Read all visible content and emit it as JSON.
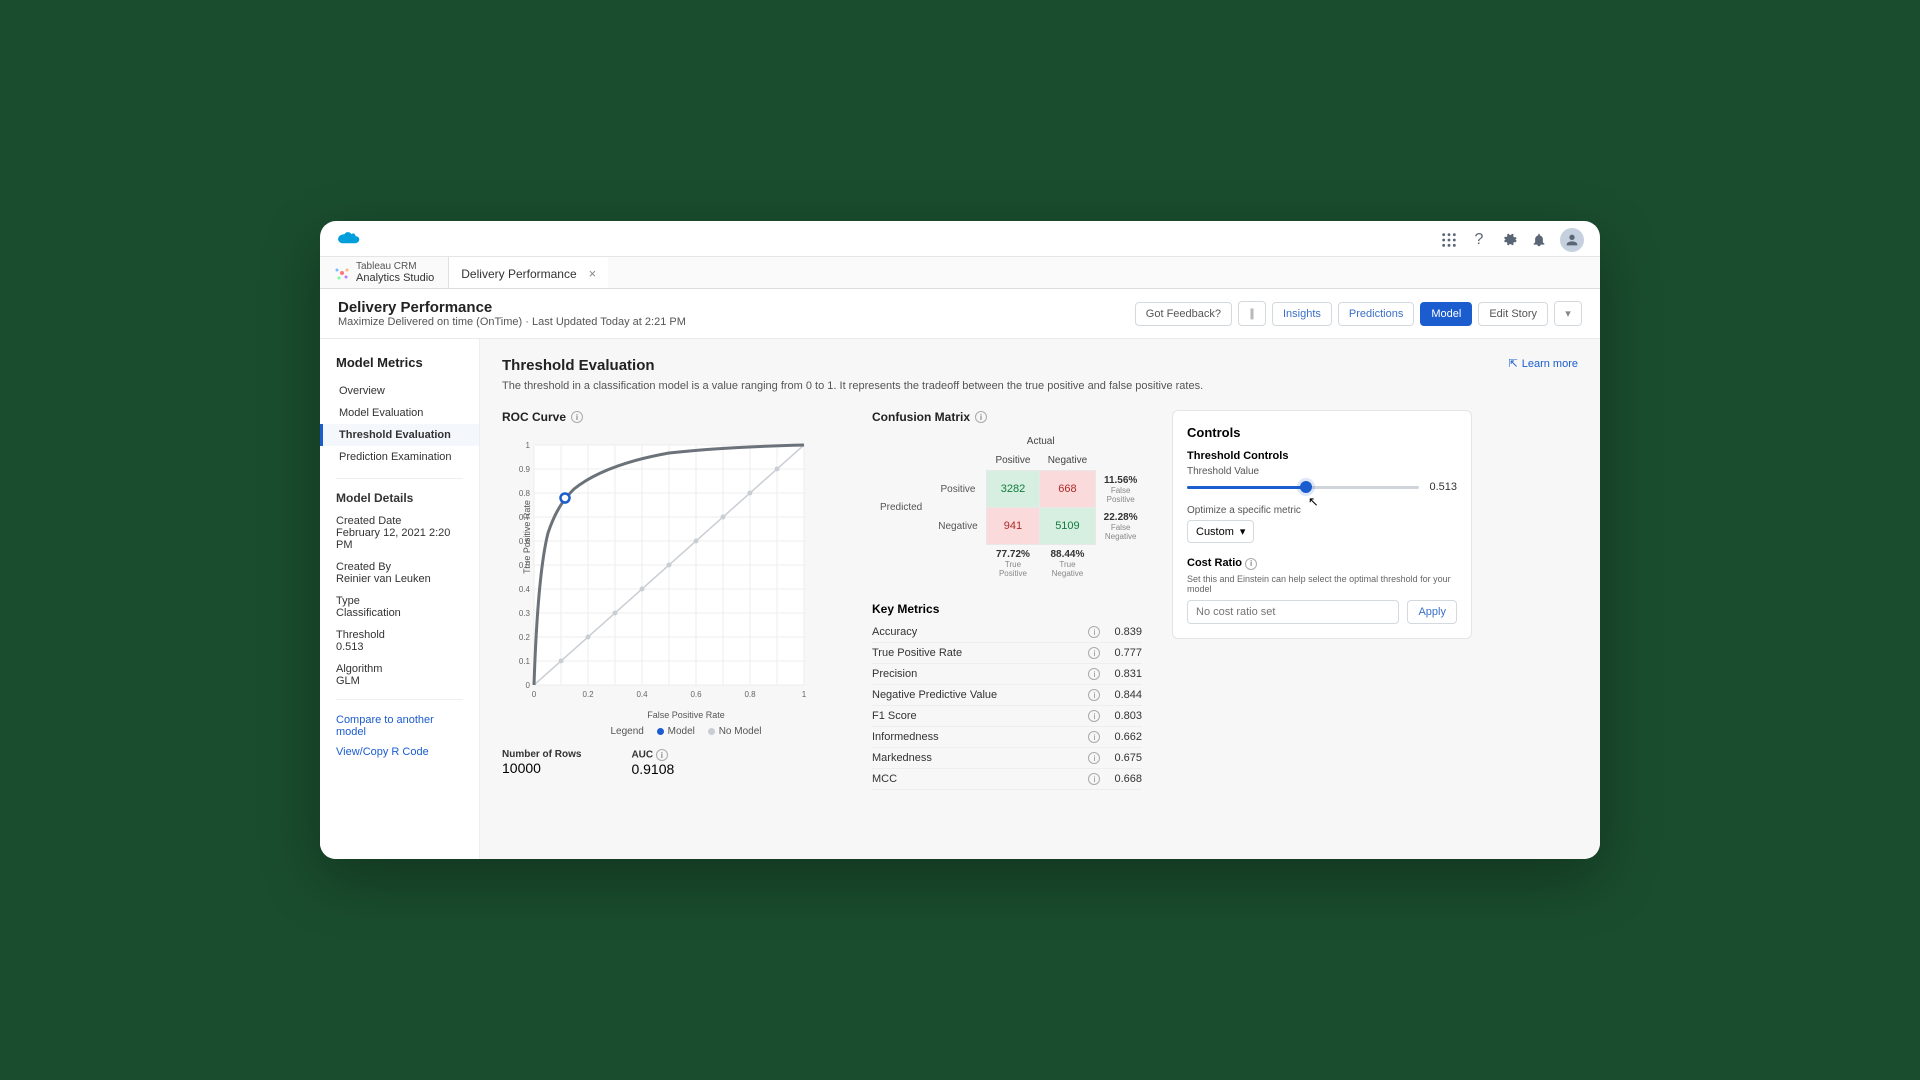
{
  "topbar": {
    "logo": "salesforce-cloud"
  },
  "app_tab": {
    "line1": "Tableau CRM",
    "line2": "Analytics Studio"
  },
  "page_tab": {
    "label": "Delivery Performance"
  },
  "page_header": {
    "title": "Delivery Performance",
    "subtitle": "Maximize Delivered on time (OnTime) · Last Updated Today at 2:21 PM"
  },
  "header_actions": {
    "got_feedback": "Got Feedback?",
    "insights": "Insights",
    "predictions": "Predictions",
    "model": "Model",
    "edit_story": "Edit Story"
  },
  "sidebar": {
    "heading": "Model Metrics",
    "items": [
      {
        "label": "Overview"
      },
      {
        "label": "Model Evaluation"
      },
      {
        "label": "Threshold Evaluation",
        "active": true
      },
      {
        "label": "Prediction Examination"
      }
    ],
    "details_heading": "Model Details",
    "meta": [
      {
        "label": "Created Date",
        "value": "February 12, 2021 2:20 PM"
      },
      {
        "label": "Created By",
        "value": "Reinier van Leuken"
      },
      {
        "label": "Type",
        "value": "Classification"
      },
      {
        "label": "Threshold",
        "value": "0.513"
      },
      {
        "label": "Algorithm",
        "value": "GLM"
      }
    ],
    "links": [
      {
        "label": "Compare to another model"
      },
      {
        "label": "View/Copy R Code"
      }
    ]
  },
  "main": {
    "title": "Threshold Evaluation",
    "desc": "The threshold in a classification model is a value ranging from 0 to 1. It represents the tradeoff between the true positive and false positive rates.",
    "learn_more": "Learn more"
  },
  "roc": {
    "title": "ROC Curve",
    "y_axis": "True Positive Rate",
    "x_axis": "False Positive Rate",
    "legend_label": "Legend",
    "legend_model": "Model",
    "legend_nomodel": "No Model",
    "rows_label": "Number of Rows",
    "rows_value": "10000",
    "auc_label": "AUC",
    "auc_value": "0.9108"
  },
  "conf": {
    "title": "Confusion Matrix",
    "actual": "Actual",
    "predicted": "Predicted",
    "positive": "Positive",
    "negative": "Negative",
    "tp": "3282",
    "fp": "668",
    "fn": "941",
    "tn": "5109",
    "fp_pct": "11.56%",
    "fp_sub": "False Positive",
    "fn_pct": "22.28%",
    "fn_sub": "False Negative",
    "col_pos_pct": "77.72%",
    "col_pos_sub": "True Positive",
    "col_neg_pct": "88.44%",
    "col_neg_sub": "True Negative"
  },
  "key_metrics": {
    "title": "Key Metrics",
    "rows": [
      {
        "label": "Accuracy",
        "value": "0.839"
      },
      {
        "label": "True Positive Rate",
        "value": "0.777"
      },
      {
        "label": "Precision",
        "value": "0.831"
      },
      {
        "label": "Negative Predictive Value",
        "value": "0.844"
      },
      {
        "label": "F1 Score",
        "value": "0.803"
      },
      {
        "label": "Informedness",
        "value": "0.662"
      },
      {
        "label": "Markedness",
        "value": "0.675"
      },
      {
        "label": "MCC",
        "value": "0.668"
      }
    ]
  },
  "controls": {
    "title": "Controls",
    "threshold_heading": "Threshold Controls",
    "threshold_label": "Threshold Value",
    "threshold_value": "0.513",
    "optimize_label": "Optimize a specific metric",
    "optimize_select": "Custom",
    "cost_heading": "Cost Ratio",
    "cost_desc": "Set this and Einstein can help select the optimal threshold for your model",
    "cost_placeholder": "No cost ratio set",
    "apply": "Apply"
  },
  "chart_data": {
    "type": "line",
    "title": "ROC Curve",
    "xlabel": "False Positive Rate",
    "ylabel": "True Positive Rate",
    "xlim": [
      0,
      1
    ],
    "ylim": [
      0,
      1
    ],
    "x_ticks": [
      0,
      0.1,
      0.2,
      0.3,
      0.4,
      0.5,
      0.6,
      0.7,
      0.8,
      0.9,
      1
    ],
    "y_ticks": [
      0,
      0.1,
      0.2,
      0.3,
      0.4,
      0.5,
      0.6,
      0.7,
      0.8,
      0.9,
      1
    ],
    "series": [
      {
        "name": "Model",
        "color": "#1b5cce",
        "x": [
          0,
          0.02,
          0.05,
          0.1,
          0.116,
          0.15,
          0.2,
          0.3,
          0.4,
          0.5,
          0.6,
          0.7,
          0.8,
          0.9,
          1
        ],
        "y": [
          0,
          0.36,
          0.62,
          0.75,
          0.777,
          0.83,
          0.88,
          0.935,
          0.96,
          0.975,
          0.985,
          0.99,
          0.995,
          0.998,
          1
        ]
      },
      {
        "name": "No Model",
        "color": "#c0c6cd",
        "x": [
          0,
          0.1,
          0.2,
          0.3,
          0.4,
          0.5,
          0.6,
          0.7,
          0.8,
          0.9,
          1
        ],
        "y": [
          0,
          0.1,
          0.2,
          0.3,
          0.4,
          0.5,
          0.6,
          0.7,
          0.8,
          0.9,
          1
        ]
      }
    ],
    "marker": {
      "x": 0.116,
      "y": 0.777
    },
    "auc": 0.9108
  }
}
